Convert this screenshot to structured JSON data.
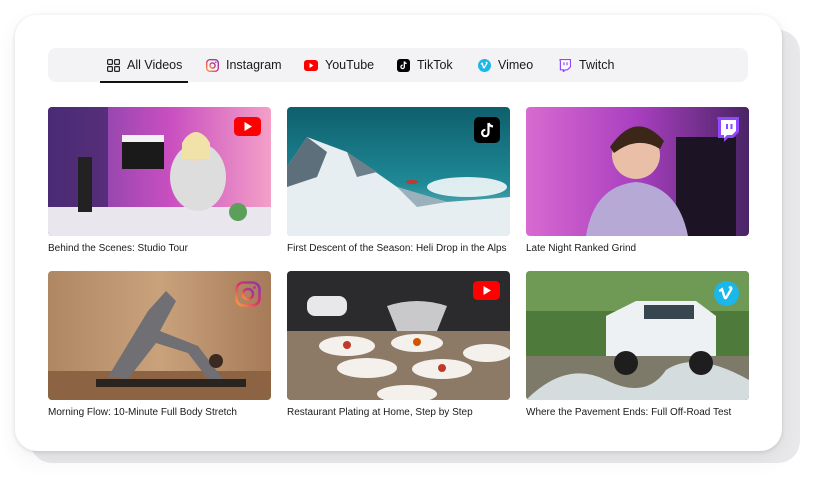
{
  "tabs": [
    {
      "label": "All Videos",
      "icon": "grid-icon",
      "active": true
    },
    {
      "label": "Instagram",
      "icon": "instagram-icon",
      "active": false
    },
    {
      "label": "YouTube",
      "icon": "youtube-icon",
      "active": false
    },
    {
      "label": "TikTok",
      "icon": "tiktok-icon",
      "active": false
    },
    {
      "label": "Vimeo",
      "icon": "vimeo-icon",
      "active": false
    },
    {
      "label": "Twitch",
      "icon": "twitch-icon",
      "active": false
    }
  ],
  "videos": [
    {
      "title": "Behind the Scenes: Studio Tour",
      "platform": "youtube-icon"
    },
    {
      "title": "First Descent of the Season: Heli Drop in the Alps",
      "platform": "tiktok-icon"
    },
    {
      "title": "Late Night Ranked Grind",
      "platform": "twitch-icon"
    },
    {
      "title": "Morning Flow: 10-Minute Full Body Stretch",
      "platform": "instagram-icon"
    },
    {
      "title": "Restaurant Plating at Home, Step by Step",
      "platform": "youtube-icon"
    },
    {
      "title": "Where the Pavement Ends: Full Off-Road Test",
      "platform": "vimeo-icon"
    }
  ],
  "colors": {
    "youtube": "#ff0000",
    "twitch": "#9146ff",
    "vimeo": "#1ab7ea",
    "tiktok": "#000000",
    "instagram": "#d62976"
  }
}
